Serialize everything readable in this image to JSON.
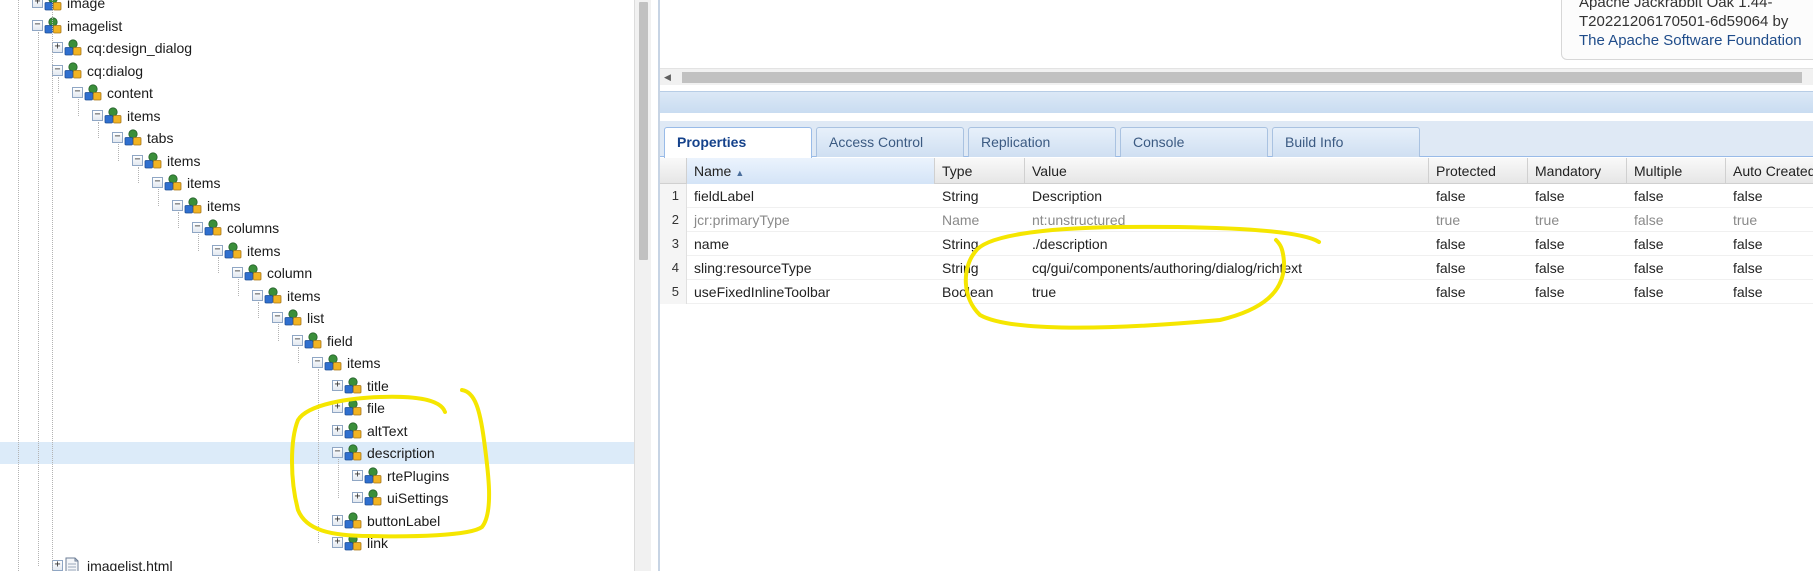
{
  "tree": {
    "nodes": [
      {
        "label": "image",
        "depth": 0,
        "expanded": false,
        "kind": "node"
      },
      {
        "label": "imagelist",
        "depth": 0,
        "expanded": true,
        "kind": "node"
      },
      {
        "label": "cq:design_dialog",
        "depth": 1,
        "expanded": false,
        "kind": "node"
      },
      {
        "label": "cq:dialog",
        "depth": 1,
        "expanded": true,
        "kind": "node"
      },
      {
        "label": "content",
        "depth": 2,
        "expanded": true,
        "kind": "node"
      },
      {
        "label": "items",
        "depth": 3,
        "expanded": true,
        "kind": "node"
      },
      {
        "label": "tabs",
        "depth": 4,
        "expanded": true,
        "kind": "node"
      },
      {
        "label": "items",
        "depth": 5,
        "expanded": true,
        "kind": "node"
      },
      {
        "label": "items",
        "depth": 6,
        "expanded": true,
        "kind": "node"
      },
      {
        "label": "items",
        "depth": 7,
        "expanded": true,
        "kind": "node"
      },
      {
        "label": "columns",
        "depth": 8,
        "expanded": true,
        "kind": "node"
      },
      {
        "label": "items",
        "depth": 9,
        "expanded": true,
        "kind": "node"
      },
      {
        "label": "column",
        "depth": 10,
        "expanded": true,
        "kind": "node"
      },
      {
        "label": "items",
        "depth": 11,
        "expanded": true,
        "kind": "node"
      },
      {
        "label": "list",
        "depth": 12,
        "expanded": true,
        "kind": "node"
      },
      {
        "label": "field",
        "depth": 13,
        "expanded": true,
        "kind": "node"
      },
      {
        "label": "items",
        "depth": 14,
        "expanded": true,
        "kind": "node"
      },
      {
        "label": "title",
        "depth": 15,
        "expanded": false,
        "kind": "node"
      },
      {
        "label": "file",
        "depth": 15,
        "expanded": false,
        "kind": "node"
      },
      {
        "label": "altText",
        "depth": 15,
        "expanded": false,
        "kind": "node"
      },
      {
        "label": "description",
        "depth": 15,
        "expanded": true,
        "kind": "node",
        "selected": true
      },
      {
        "label": "rtePlugins",
        "depth": 16,
        "expanded": false,
        "kind": "node"
      },
      {
        "label": "uiSettings",
        "depth": 16,
        "expanded": false,
        "kind": "node"
      },
      {
        "label": "buttonLabel",
        "depth": 15,
        "expanded": false,
        "kind": "node"
      },
      {
        "label": "link",
        "depth": 15,
        "expanded": false,
        "kind": "node"
      },
      {
        "label": "imagelist.html",
        "depth": 1,
        "expanded": false,
        "kind": "file"
      }
    ]
  },
  "about": {
    "line1": "Apache Jackrabbit Oak 1.44-",
    "line2": "T20221206170501-6d59064 by",
    "link": "The Apache Software Foundation"
  },
  "tabs": [
    {
      "label": "Properties",
      "active": true
    },
    {
      "label": "Access Control",
      "active": false
    },
    {
      "label": "Replication",
      "active": false
    },
    {
      "label": "Console",
      "active": false
    },
    {
      "label": "Build Info",
      "active": false
    }
  ],
  "grid": {
    "columns": [
      "Name",
      "Type",
      "Value",
      "Protected",
      "Mandatory",
      "Multiple",
      "Auto Created"
    ],
    "sorted_column": "Name",
    "rows": [
      {
        "num": "1",
        "name": "fieldLabel",
        "type": "String",
        "value": "Description",
        "protected": "false",
        "mandatory": "false",
        "multiple": "false",
        "auto": "false",
        "is_protected": false
      },
      {
        "num": "2",
        "name": "jcr:primaryType",
        "type": "Name",
        "value": "nt:unstructured",
        "protected": "true",
        "mandatory": "true",
        "multiple": "false",
        "auto": "true",
        "is_protected": true
      },
      {
        "num": "3",
        "name": "name",
        "type": "String",
        "value": "./description",
        "protected": "false",
        "mandatory": "false",
        "multiple": "false",
        "auto": "false",
        "is_protected": false
      },
      {
        "num": "4",
        "name": "sling:resourceType",
        "type": "String",
        "value": "cq/gui/components/authoring/dialog/richtext",
        "protected": "false",
        "mandatory": "false",
        "multiple": "false",
        "auto": "false",
        "is_protected": false
      },
      {
        "num": "5",
        "name": "useFixedInlineToolbar",
        "type": "Boolean",
        "value": "true",
        "protected": "false",
        "mandatory": "false",
        "multiple": "false",
        "auto": "false",
        "is_protected": false
      }
    ]
  },
  "colors": {
    "annotation": "#f5e600",
    "selected_row": "#dcebf9",
    "tab_active_text": "#15428b"
  },
  "icons": {
    "node": "node-icon",
    "file": "file-icon",
    "expand": "expand-icon",
    "collapse": "collapse-icon",
    "sort": "sort-asc-icon"
  }
}
